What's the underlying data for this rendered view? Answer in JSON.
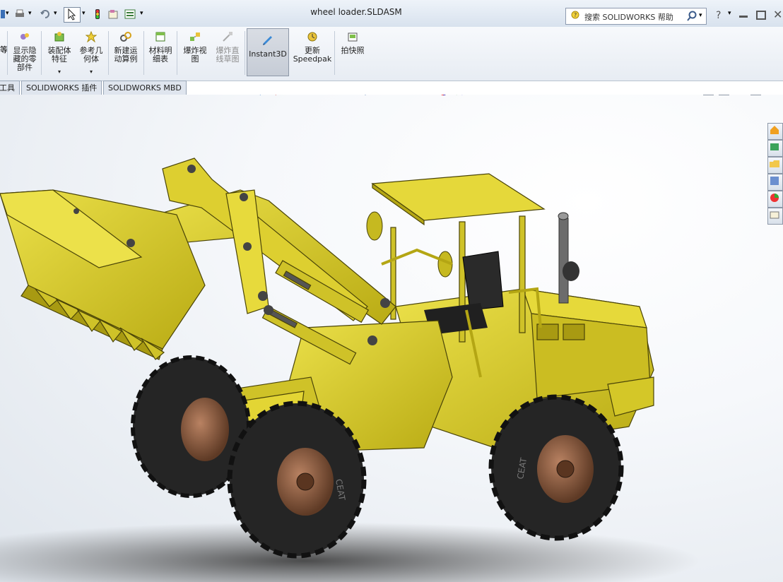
{
  "window": {
    "title": "wheel loader.SLDASM",
    "search_placeholder": "搜索 SOLIDWORKS 帮助"
  },
  "ribbon": {
    "show_hidden": "显示隐\n藏的零\n部件",
    "assembly_feature": "装配体\n特征",
    "reference_geometry": "参考几\n何体",
    "new_motion_study": "新建运\n动算例",
    "bom": "材料明\n细表",
    "exploded_view": "爆炸视\n图",
    "explode_line_sketch": "爆炸直\n线草图",
    "instant3d": "Instant3D",
    "update_speedpak": "更新\nSpeedpak",
    "snapshot": "拍快照"
  },
  "tabs": [
    "工具",
    "SOLIDWORKS 插件",
    "SOLIDWORKS MBD"
  ],
  "model": {
    "tire_brand": "CEAT"
  },
  "colors": {
    "body_yellow": "#d8c820",
    "body_dark": "#8f8412",
    "tire_black": "#252525",
    "hub_bronze": "#8a5a3c",
    "accent_blue": "#2b73c7",
    "background": "#eef2f6"
  }
}
